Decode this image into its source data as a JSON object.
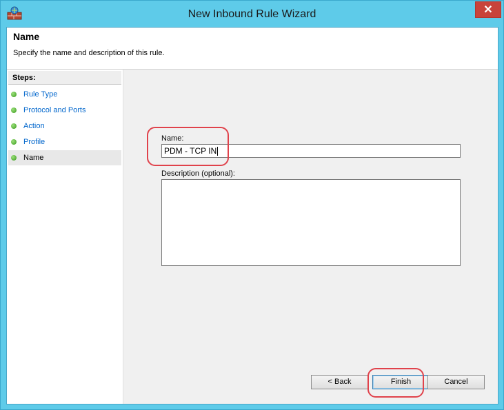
{
  "window": {
    "title": "New Inbound Rule Wizard",
    "close_glyph": "✕",
    "app_icon": "firewall-icon"
  },
  "header": {
    "title": "Name",
    "subtitle": "Specify the name and description of this rule."
  },
  "steps": {
    "heading": "Steps:",
    "items": [
      {
        "label": "Rule Type",
        "current": false
      },
      {
        "label": "Protocol and Ports",
        "current": false
      },
      {
        "label": "Action",
        "current": false
      },
      {
        "label": "Profile",
        "current": false
      },
      {
        "label": "Name",
        "current": true
      }
    ]
  },
  "form": {
    "name_label": "Name:",
    "name_value": "PDM - TCP IN",
    "description_label": "Description (optional):",
    "description_value": ""
  },
  "buttons": {
    "back": "< Back",
    "finish": "Finish",
    "cancel": "Cancel"
  },
  "colors": {
    "titlebar": "#5ecbe9",
    "close_button": "#c8433a",
    "step_link": "#0066cc",
    "annotation_highlight": "#e0424b"
  }
}
